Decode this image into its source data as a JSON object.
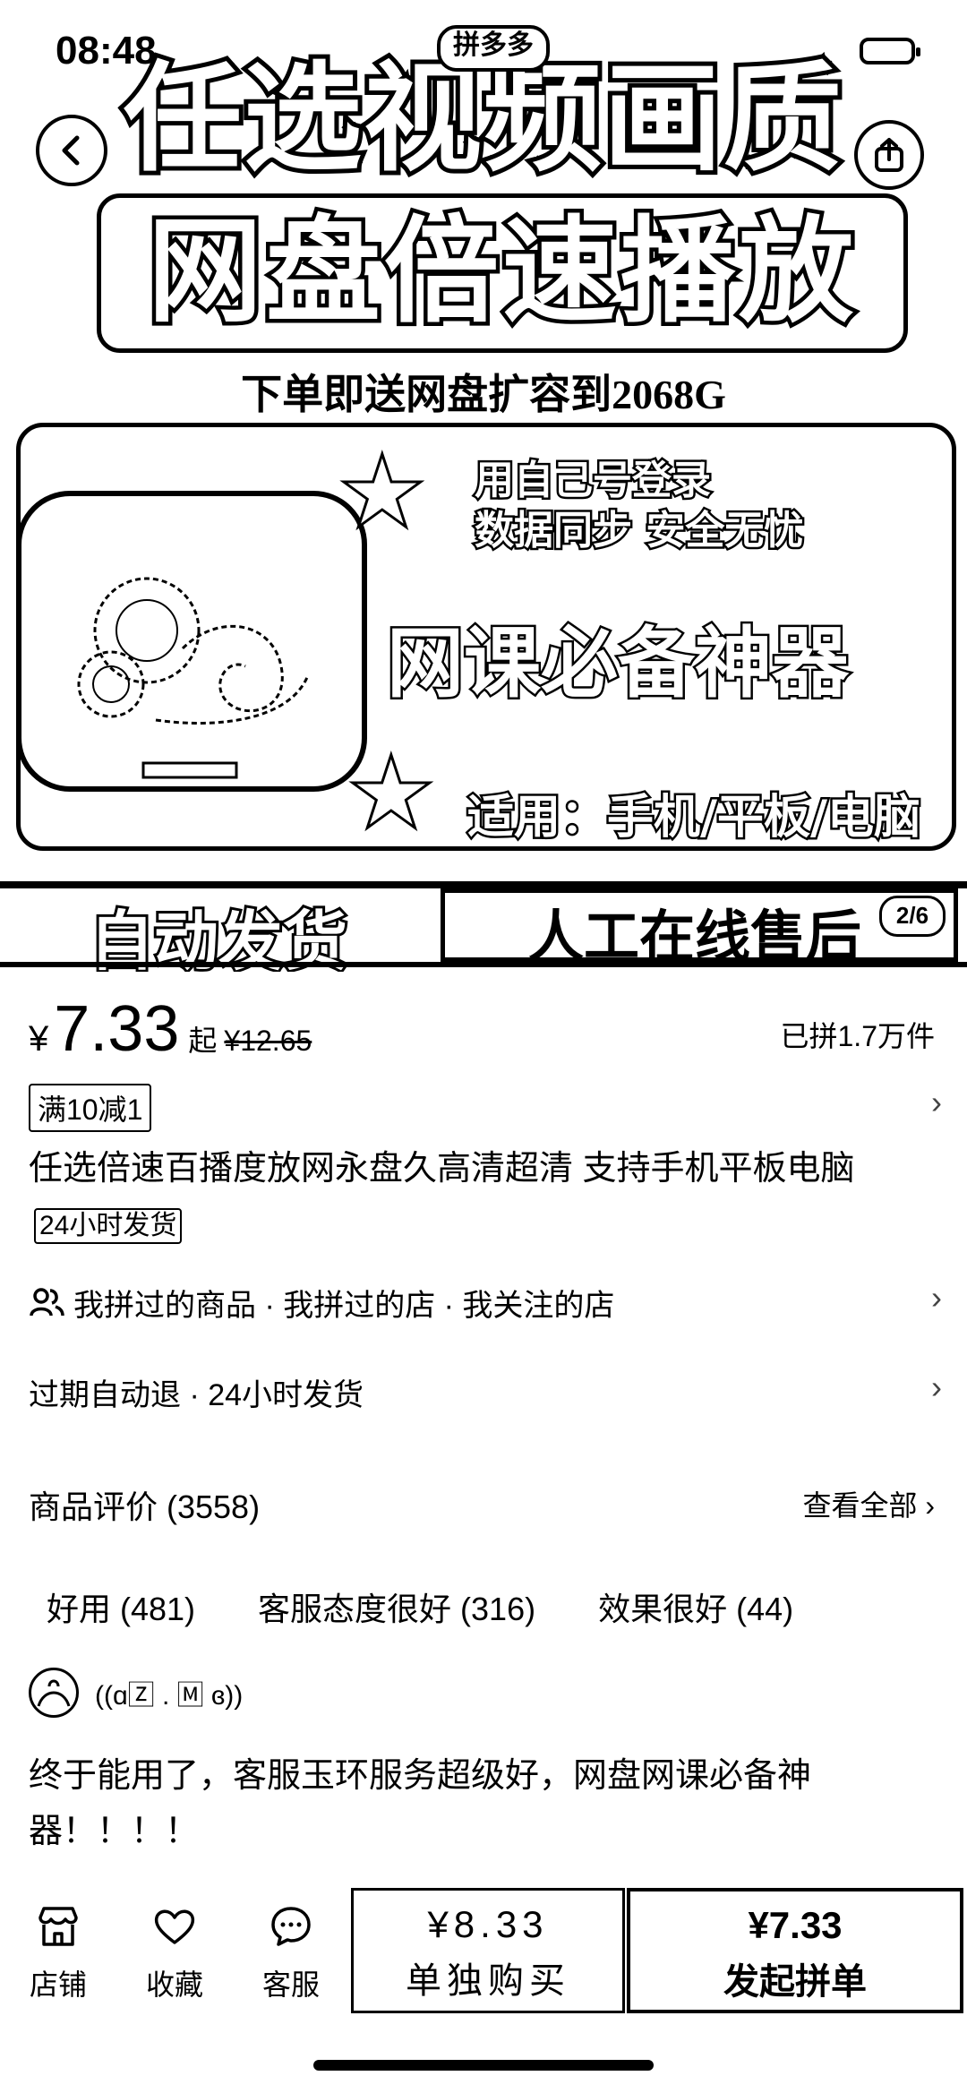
{
  "status_bar": {
    "time": "08:48"
  },
  "banner": {
    "badge": "拼多多",
    "headline1": "任选视频画质",
    "headline2": "网盘倍速播放",
    "subline": "下单即送网盘扩容到2068G",
    "feature1_line1": "用自己号登录",
    "feature1_line2": "数据同步 安全无忧",
    "feature_main": "网课必备神器",
    "feature2": "适用：手机/平板/电脑",
    "tag_left": "自动发货",
    "tag_right": "人工在线售后",
    "image_counter": "2/6"
  },
  "product": {
    "currency": "¥",
    "price": "7.33",
    "price_suffix": "起",
    "original_price": "¥12.65",
    "sold": "已拼1.7万件",
    "coupon": "满10减1",
    "title": "任选倍速百播度放网永盘久高清超清 支持手机平板电脑",
    "title_tag": "24小时发货",
    "social": "我拼过的商品 · 我拼过的店 · 我关注的店",
    "service": "过期自动退 · 24小时发货"
  },
  "reviews": {
    "header": "商品评价 (3558)",
    "view_all": "查看全部",
    "chips": [
      "好用 (481)",
      "客服态度很好 (316)",
      "效果很好 (44)"
    ],
    "username": "((ɑ🅉 . 🄼 ɞ))",
    "text": "终于能用了，客服玉环服务超级好，网盘网课必备神器！！！！"
  },
  "bottom_bar": {
    "tabs": [
      {
        "label": "店铺",
        "icon": "store-icon"
      },
      {
        "label": "收藏",
        "icon": "heart-icon"
      },
      {
        "label": "客服",
        "icon": "chat-icon"
      }
    ],
    "single_price": "¥8.33",
    "single_label": "单独购买",
    "group_price": "¥7.33",
    "group_label": "发起拼单"
  }
}
